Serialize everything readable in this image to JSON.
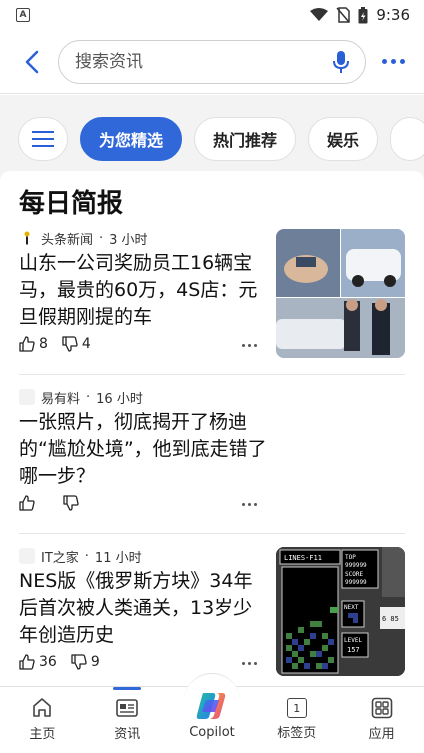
{
  "status_bar": {
    "time": "9:36",
    "app_icon_letter": "A"
  },
  "search": {
    "placeholder": "搜索资讯"
  },
  "tabs": [
    "为您精选",
    "热门推荐",
    "娱乐"
  ],
  "card_title": "每日简报",
  "articles": [
    {
      "source": "头条新闻",
      "time": "3 小时",
      "title": "山东一公司奖励员工16辆宝马，最贵的60万，4S店：元旦假期刚提的车",
      "likes": "8",
      "dislikes": "4"
    },
    {
      "source": "易有料",
      "time": "16 小时",
      "title": "一张照片，彻底揭开了杨迪的“尴尬处境”，他到底走错了哪一步？",
      "likes": "",
      "dislikes": ""
    },
    {
      "source": "IT之家",
      "time": "11 小时",
      "title": "NES版《俄罗斯方块》34年后首次被人类通关，13岁少年创造历史",
      "likes": "36",
      "dislikes": "9"
    }
  ],
  "tetris_thumb": {
    "lines": "LINES-F11",
    "top_label": "TOP",
    "top_value": "999999",
    "score_label": "SCORE",
    "score_value": "999999",
    "next_label": "NEXT",
    "level_label": "LEVEL",
    "level_value": "157",
    "side_value": "6 85"
  },
  "bottom_nav": [
    "主页",
    "资讯",
    "Copilot",
    "标签页",
    "应用"
  ],
  "tab_count": "1",
  "colors": {
    "accent": "#3068d9",
    "background": "#f3f3f3"
  }
}
